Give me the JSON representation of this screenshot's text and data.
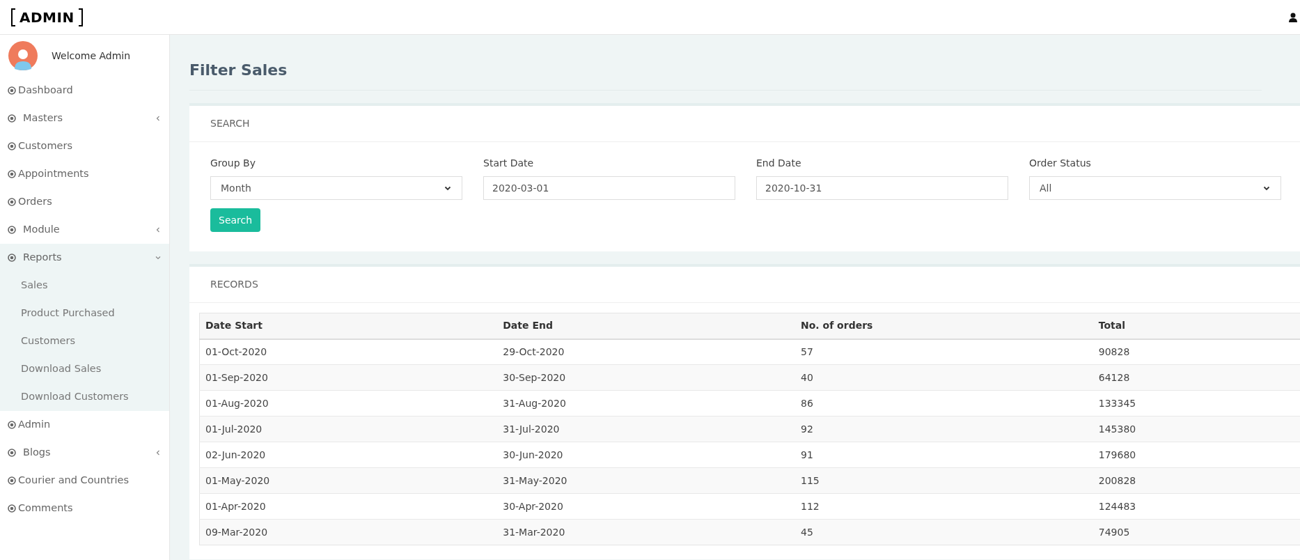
{
  "header": {
    "logo": "ADMIN"
  },
  "sidebar": {
    "welcome": "Welcome Admin",
    "items": [
      {
        "label": "Dashboard",
        "kind": "link"
      },
      {
        "label": "Masters",
        "kind": "group",
        "expanded": false
      },
      {
        "label": "Customers",
        "kind": "link"
      },
      {
        "label": "Appointments",
        "kind": "link"
      },
      {
        "label": "Orders",
        "kind": "link"
      },
      {
        "label": "Module",
        "kind": "group",
        "expanded": false
      },
      {
        "label": "Reports",
        "kind": "group",
        "expanded": true,
        "children": [
          {
            "label": "Sales"
          },
          {
            "label": "Product Purchased"
          },
          {
            "label": "Customers"
          },
          {
            "label": "Download Sales"
          },
          {
            "label": "Download Customers"
          }
        ]
      },
      {
        "label": "Admin",
        "kind": "link"
      },
      {
        "label": "Blogs",
        "kind": "group",
        "expanded": false
      },
      {
        "label": "Courier and Countries",
        "kind": "link"
      },
      {
        "label": "Comments",
        "kind": "link"
      }
    ]
  },
  "page_title": "Filter Sales",
  "search_panel": {
    "heading": "SEARCH",
    "fields": [
      {
        "label": "Group By",
        "kind": "select",
        "value": "Month"
      },
      {
        "label": "Start Date",
        "kind": "text",
        "value": "2020-03-01"
      },
      {
        "label": "End Date",
        "kind": "text",
        "value": "2020-10-31"
      },
      {
        "label": "Order Status",
        "kind": "select",
        "value": "All"
      }
    ],
    "button": "Search"
  },
  "records_panel": {
    "heading": "RECORDS",
    "table": {
      "columns": [
        "Date Start",
        "Date End",
        "No. of orders",
        "Total"
      ],
      "rows": [
        [
          "01-Oct-2020",
          "29-Oct-2020",
          "57",
          "90828"
        ],
        [
          "01-Sep-2020",
          "30-Sep-2020",
          "40",
          "64128"
        ],
        [
          "01-Aug-2020",
          "31-Aug-2020",
          "86",
          "133345"
        ],
        [
          "01-Jul-2020",
          "31-Jul-2020",
          "92",
          "145380"
        ],
        [
          "02-Jun-2020",
          "30-Jun-2020",
          "91",
          "179680"
        ],
        [
          "01-May-2020",
          "31-May-2020",
          "115",
          "200828"
        ],
        [
          "01-Apr-2020",
          "30-Apr-2020",
          "112",
          "124483"
        ],
        [
          "09-Mar-2020",
          "31-Mar-2020",
          "45",
          "74905"
        ]
      ]
    }
  }
}
